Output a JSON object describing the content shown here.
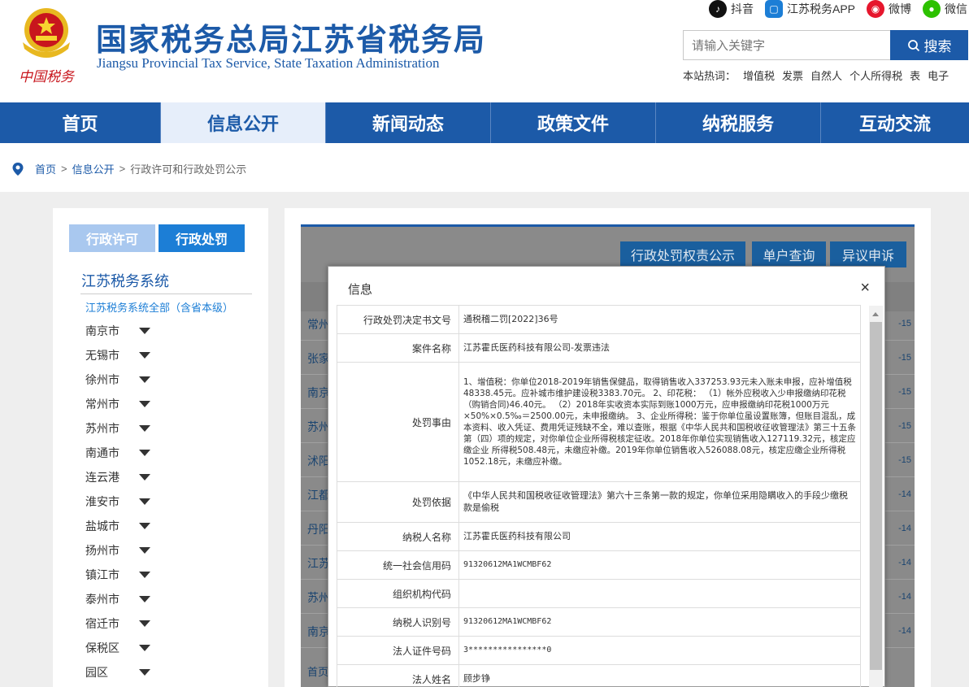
{
  "header": {
    "title": "国家税务总局江苏省税务局",
    "subtitle": "Jiangsu Provincial Tax Service, State Taxation Administration",
    "logo_text": "中国税务",
    "social": [
      {
        "label": "抖音",
        "icon": "douyin-icon",
        "color": "#111111"
      },
      {
        "label": "江苏税务APP",
        "icon": "app-icon",
        "color": "#1c7ed6"
      },
      {
        "label": "微博",
        "icon": "weibo-icon",
        "color": "#e6162d"
      },
      {
        "label": "微信",
        "icon": "wechat-icon",
        "color": "#2dc100"
      }
    ],
    "search": {
      "placeholder": "请输入关键字",
      "button": "搜索"
    },
    "hot": {
      "label": "本站热词：",
      "words": [
        "增值税",
        "发票",
        "自然人",
        "个人所得税",
        "表",
        "电子"
      ]
    }
  },
  "nav": [
    "首页",
    "信息公开",
    "新闻动态",
    "政策文件",
    "纳税服务",
    "互动交流"
  ],
  "breadcrumb": [
    "首页",
    "信息公开",
    "行政许可和行政处罚公示"
  ],
  "sidebar": {
    "tabs": [
      "行政许可",
      "行政处罚"
    ],
    "heading": "江苏税务系统",
    "all_label": "江苏税务系统全部（含省本级）",
    "cities": [
      "南京市",
      "无锡市",
      "徐州市",
      "常州市",
      "苏州市",
      "南通市",
      "连云港",
      "淮安市",
      "盐城市",
      "扬州市",
      "镇江市",
      "泰州市",
      "宿迁市",
      "保税区",
      "园区"
    ]
  },
  "main": {
    "buttons": [
      "行政处罚权责公示",
      "单户查询",
      "异议申诉"
    ],
    "rows_left": [
      "常州",
      "张家",
      "南京",
      "苏州",
      "沭阳",
      "江都",
      "丹阳",
      "江苏",
      "苏州",
      "南京",
      "首页"
    ],
    "rows_right": [
      "-15",
      "-15",
      "-15",
      "-15",
      "-15",
      "-14",
      "-14",
      "-14",
      "-14",
      "-14"
    ]
  },
  "modal": {
    "title": "信息",
    "close": "×",
    "fields": [
      {
        "label": "行政处罚决定书文号",
        "value": "通税稽二罚[2022]36号"
      },
      {
        "label": "案件名称",
        "value": "江苏霍氏医药科技有限公司-发票违法"
      },
      {
        "label": "处罚事由",
        "value": "1、增值税：你单位2018-2019年销售保健品，取得销售收入337253.93元未入账未申报，应补增值税48338.45元。应补城市维护建设税3383.70元。 2、印花税： （1）帐外应税收入少申报缴纳印花税（购销合同)46.40元。 （2）2018年实收资本实际到账1000万元，应申报缴纳印花税1000万元×50%×0.5‰＝2500.00元，未申报缴纳。 3、企业所得税：鉴于你单位虽设置账簿，但账目混乱，成本资料、收入凭证、费用凭证残缺不全，难以查账，根据《中华人民共和国税收征收管理法》第三十五条第（四）项的规定，对你单位企业所得税核定征收。2018年你单位实现销售收入127119.32元，核定应缴企业 所得税508.48元，未缴应补缴。2019年你单位销售收入526088.08元，核定应缴企业所得税1052.18元，未缴应补缴。"
      },
      {
        "label": "处罚依据",
        "value": "《中华人民共和国税收征收管理法》第六十三条第一款的规定，你单位采用隐瞒收入的手段少缴税款是偷税"
      },
      {
        "label": "纳税人名称",
        "value": "江苏霍氏医药科技有限公司"
      },
      {
        "label": "统一社会信用码",
        "value": "91320612MA1WCMBF62"
      },
      {
        "label": "组织机构代码",
        "value": ""
      },
      {
        "label": "纳税人识别号",
        "value": "91320612MA1WCMBF62"
      },
      {
        "label": "法人证件号码",
        "value": "3****************0"
      },
      {
        "label": "法人姓名",
        "value": "顾步铮"
      }
    ]
  },
  "colors": {
    "brand": "#1c5aa8",
    "accent": "#1c7ed6",
    "overlay": "#8a8a8a"
  }
}
